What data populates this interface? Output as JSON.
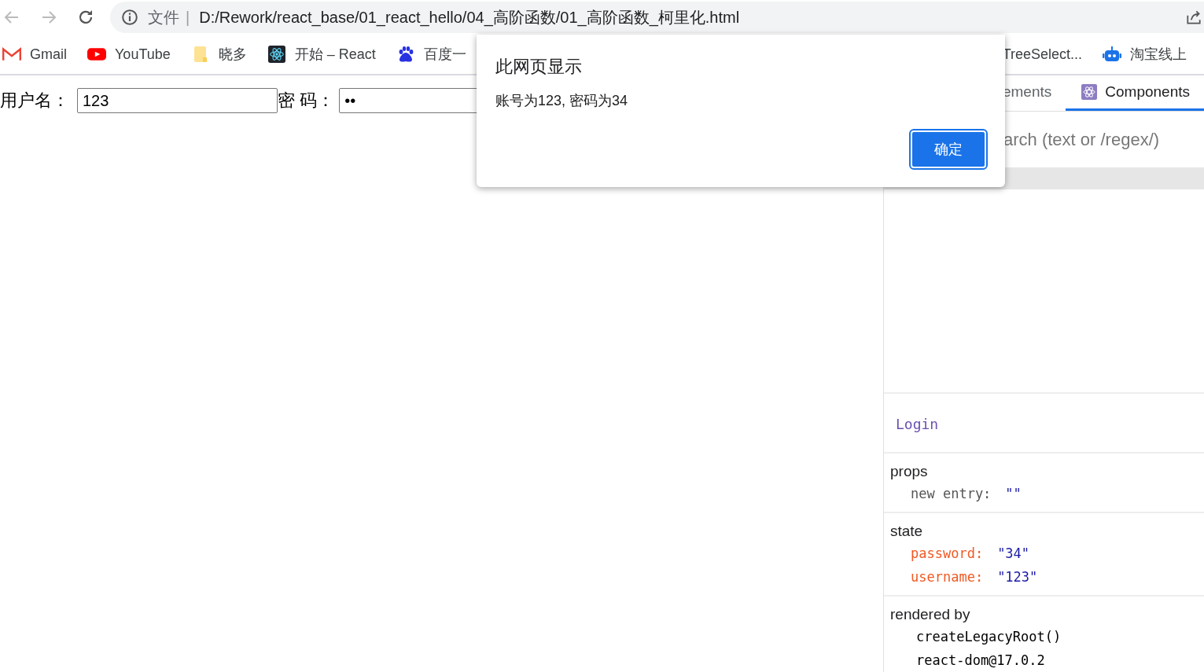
{
  "browser": {
    "address": {
      "scheme_label": "文件",
      "separator": "|",
      "url": "D:/Rework/react_base/01_react_hello/04_高阶函数/01_高阶函数_柯里化.html"
    },
    "bookmarks": [
      {
        "label": "Gmail",
        "kind": "gmail"
      },
      {
        "label": "YouTube",
        "kind": "youtube"
      },
      {
        "label": "晓多",
        "kind": "folder"
      },
      {
        "label": "开始 – React",
        "kind": "react"
      },
      {
        "label": "百度一",
        "kind": "baidu"
      }
    ],
    "bookmarks_right": [
      {
        "label": "TreeSelect...",
        "kind": "none"
      },
      {
        "label": "淘宝线上",
        "kind": "robot"
      }
    ]
  },
  "page": {
    "fields": [
      {
        "label": "用户名：",
        "value": "123",
        "kind": "text"
      },
      {
        "label": "密 码：",
        "value": "••",
        "kind": "password"
      }
    ]
  },
  "dialog": {
    "title": "此网页显示",
    "message": "账号为123, 密码为34",
    "button": "确定"
  },
  "devtools": {
    "tabs": [
      {
        "label": "ements",
        "selected": false
      },
      {
        "label": "Components",
        "selected": true
      }
    ],
    "search": {
      "placeholder": "arch (text or /regex/)"
    },
    "inspector": {
      "component": "Login",
      "sections": [
        {
          "heading": "props",
          "kind": "props",
          "items": [
            {
              "key": "new entry:",
              "value": "\"\""
            }
          ]
        },
        {
          "heading": "state",
          "kind": "state",
          "items": [
            {
              "key": "password:",
              "value": "\"34\""
            },
            {
              "key": "username:",
              "value": "\"123\""
            }
          ]
        }
      ],
      "rendered_by": {
        "heading": "rendered by",
        "items": [
          "createLegacyRoot()",
          "react-dom@17.0.2"
        ]
      }
    }
  }
}
